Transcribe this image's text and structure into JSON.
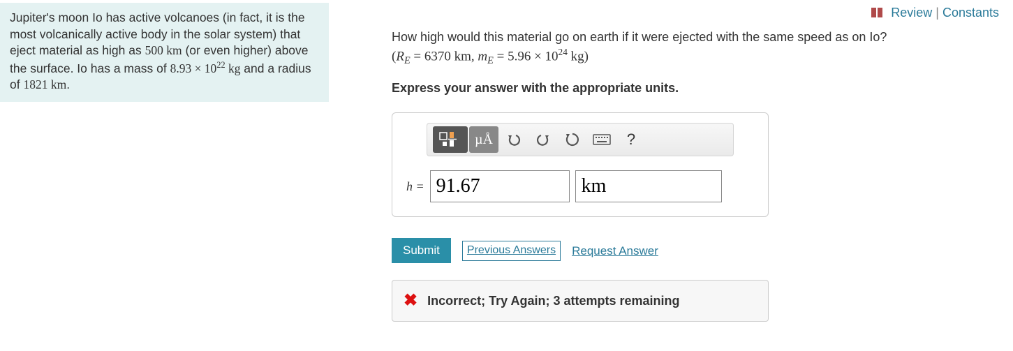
{
  "topLinks": {
    "review": "Review",
    "constants": "Constants"
  },
  "context": {
    "line1a": "Jupiter's moon Io has active volcanoes (in fact, it is the most volcanically active body in the solar system) that eject material as high as ",
    "height": "500 km",
    "line1b": " (or even higher) above the surface. Io has a mass of ",
    "mass_coeff": "8.93 × 10",
    "mass_exp": "22",
    "mass_unit": " kg",
    "line1c": " and a radius of ",
    "radius": "1821 km",
    "period": "."
  },
  "question": {
    "prompt": "How high would this material go on earth if it were ejected with the same speed as on Io?",
    "given_open": "(",
    "RE_sym": "R",
    "RE_sub": "E",
    "RE_eq": " = ",
    "RE_val": "6370 km",
    "comma": ", ",
    "mE_sym": "m",
    "mE_sub": "E",
    "mE_eq": " = ",
    "mE_coeff": "5.96 × 10",
    "mE_exp": "24",
    "mE_unit": " kg",
    "given_close": ")",
    "instruction": "Express your answer with the appropriate units."
  },
  "toolbar": {
    "templates": "templates-button",
    "units_label": "µÅ",
    "undo": "↶",
    "redo": "↷",
    "reset": "↺",
    "help": "?"
  },
  "answer": {
    "var_label": "h = ",
    "value": "91.67",
    "unit": "km"
  },
  "actions": {
    "submit": "Submit",
    "previous": "Previous Answers",
    "request": "Request Answer"
  },
  "feedback": {
    "text": "Incorrect; Try Again; 3 attempts remaining"
  }
}
